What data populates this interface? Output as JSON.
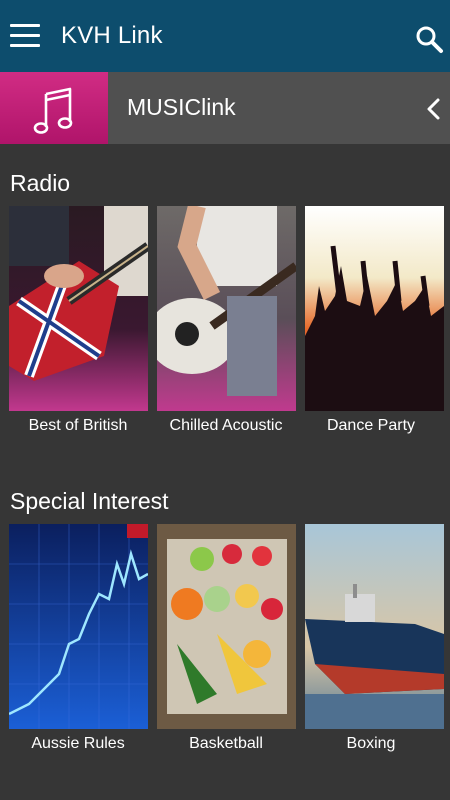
{
  "appbar": {
    "title": "KVH Link",
    "menu_icon": "hamburger-menu-icon",
    "search_icon": "search-icon",
    "color": "#0d4d6d"
  },
  "section_header": {
    "label": "MUSIClink",
    "icon": "music-note-icon",
    "back_icon": "chevron-left-icon",
    "accent": "#c41d78"
  },
  "radio": {
    "title": "Radio",
    "items": [
      {
        "label": "Best of British"
      },
      {
        "label": "Chilled Acoustic"
      },
      {
        "label": "Dance Party"
      }
    ]
  },
  "special": {
    "title": "Special Interest",
    "items": [
      {
        "label": "Aussie Rules"
      },
      {
        "label": "Basketball"
      },
      {
        "label": "Boxing"
      }
    ]
  }
}
